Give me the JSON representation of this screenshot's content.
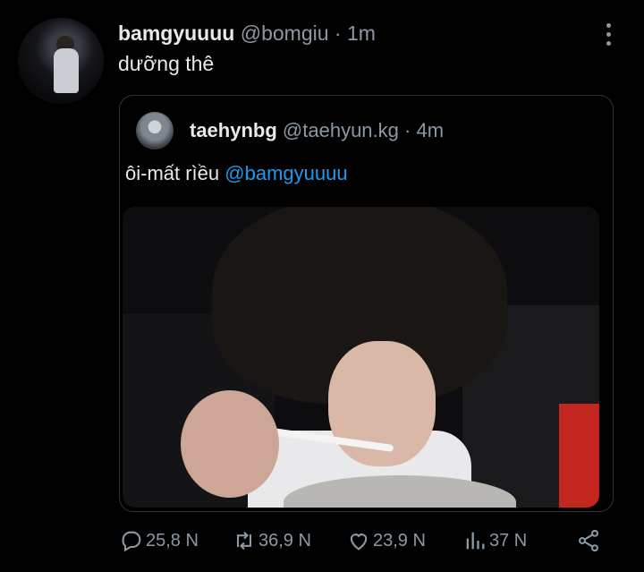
{
  "tweet": {
    "name": "bamgyuuuu",
    "handle": "@bomgiu",
    "separator": "·",
    "time": "1m",
    "text": "dưỡng thê"
  },
  "quote": {
    "name": "taehynbg",
    "handle": "@taehyun.kg",
    "separator": "·",
    "time": "4m",
    "text": "ôi-mất rìều",
    "mention": "@bamgyuuuu"
  },
  "actions": {
    "reply_count": "25,8 N",
    "retweet_count": "36,9 N",
    "like_count": "23,9 N",
    "views_count": "37 N"
  },
  "icons": {
    "more": "more-icon",
    "reply": "reply-icon",
    "retweet": "retweet-icon",
    "like": "like-icon",
    "views": "views-icon",
    "share": "share-icon"
  },
  "colors": {
    "background": "#000000",
    "text": "#e7e9ea",
    "muted": "#8b98a5",
    "mention": "#1d9bf0",
    "border": "#2f3336"
  }
}
